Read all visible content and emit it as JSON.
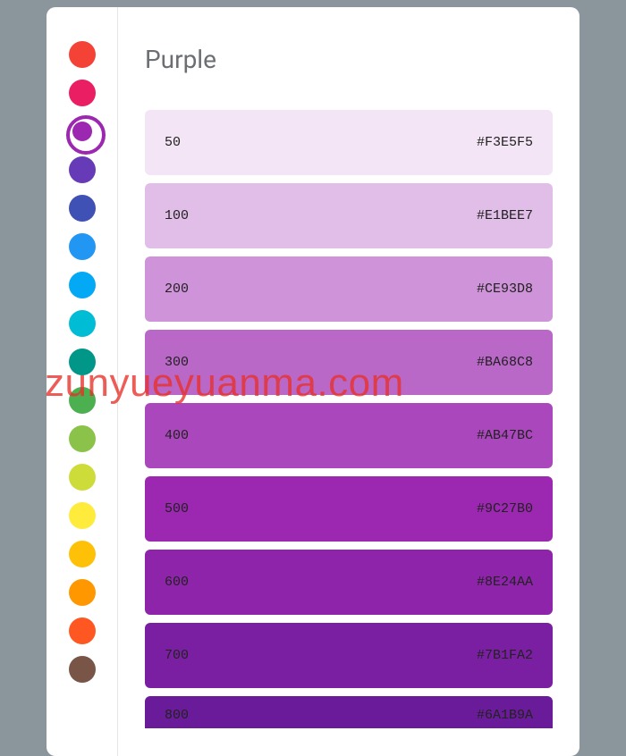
{
  "title": "Purple",
  "watermark": "zunyueyuanma.com",
  "sidebar_colors": [
    {
      "name": "red",
      "hex": "#F44336",
      "selected": false
    },
    {
      "name": "pink",
      "hex": "#E91E63",
      "selected": false
    },
    {
      "name": "purple",
      "hex": "#9C27B0",
      "selected": true
    },
    {
      "name": "deep-purple",
      "hex": "#673AB7",
      "selected": false
    },
    {
      "name": "indigo",
      "hex": "#3F51B5",
      "selected": false
    },
    {
      "name": "blue",
      "hex": "#2196F3",
      "selected": false
    },
    {
      "name": "light-blue",
      "hex": "#03A9F4",
      "selected": false
    },
    {
      "name": "cyan",
      "hex": "#00BCD4",
      "selected": false
    },
    {
      "name": "teal",
      "hex": "#009688",
      "selected": false
    },
    {
      "name": "green",
      "hex": "#4CAF50",
      "selected": false
    },
    {
      "name": "light-green",
      "hex": "#8BC34A",
      "selected": false
    },
    {
      "name": "lime",
      "hex": "#CDDC39",
      "selected": false
    },
    {
      "name": "yellow",
      "hex": "#FFEB3B",
      "selected": false
    },
    {
      "name": "amber",
      "hex": "#FFC107",
      "selected": false
    },
    {
      "name": "orange",
      "hex": "#FF9800",
      "selected": false
    },
    {
      "name": "deep-orange",
      "hex": "#FF5722",
      "selected": false
    },
    {
      "name": "brown",
      "hex": "#795548",
      "selected": false
    }
  ],
  "swatches": [
    {
      "shade": "50",
      "hex": "#F3E5F5",
      "text": "dark"
    },
    {
      "shade": "100",
      "hex": "#E1BEE7",
      "text": "dark"
    },
    {
      "shade": "200",
      "hex": "#CE93D8",
      "text": "dark"
    },
    {
      "shade": "300",
      "hex": "#BA68C8",
      "text": "dark"
    },
    {
      "shade": "400",
      "hex": "#AB47BC",
      "text": "dark"
    },
    {
      "shade": "500",
      "hex": "#9C27B0",
      "text": "dark"
    },
    {
      "shade": "600",
      "hex": "#8E24AA",
      "text": "dark"
    },
    {
      "shade": "700",
      "hex": "#7B1FA2",
      "text": "dark"
    },
    {
      "shade": "800",
      "hex": "#6A1B9A",
      "text": "dark",
      "partial": true
    }
  ]
}
